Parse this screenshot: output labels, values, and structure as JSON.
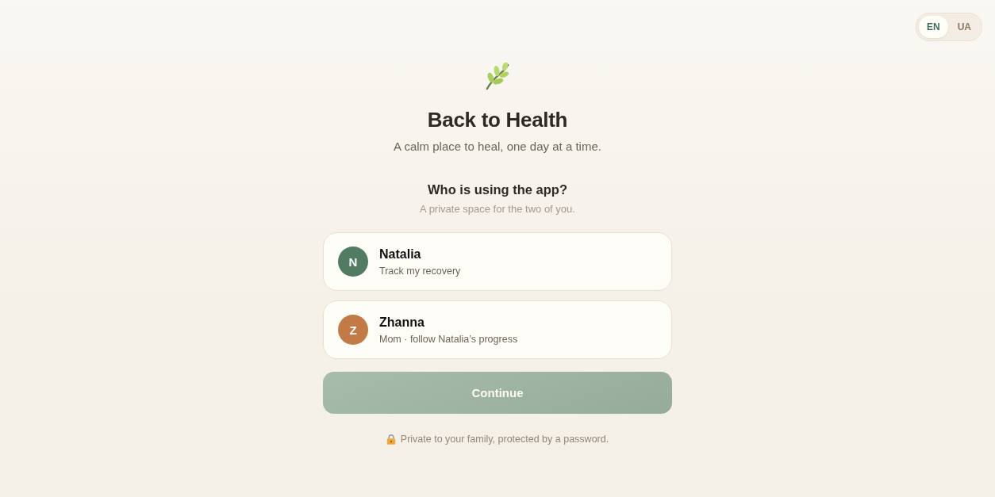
{
  "language_toggle": [
    {
      "label": "EN",
      "selected": true
    },
    {
      "label": "UA",
      "selected": false
    }
  ],
  "brand": {
    "title": "Back to Health",
    "tagline": "A calm place to heal, one day at a time."
  },
  "prompt": {
    "title": "Who is using the app?",
    "subtitle": "A private space for the two of you."
  },
  "profiles": [
    {
      "initial": "N",
      "name": "Natalia",
      "description": "Track my recovery",
      "color": "#517b63",
      "selected": false
    },
    {
      "initial": "Z",
      "name": "Zhanna",
      "description": "Mom · follow Natalia’s progress",
      "color": "#c27b47",
      "selected": false
    }
  ],
  "continue_button": {
    "label": "Continue",
    "disabled": true
  },
  "footer_note": "Private to your family, protected by a password."
}
